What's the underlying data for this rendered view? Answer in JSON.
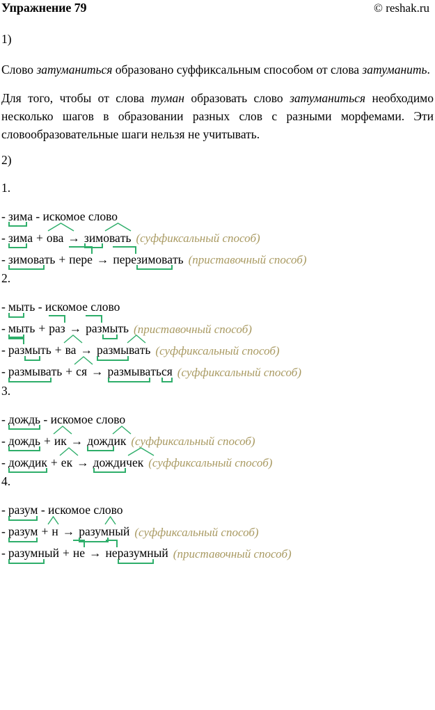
{
  "header": {
    "exercise_title": "Упражнение 79",
    "copyright": "© reshak.ru"
  },
  "parts": {
    "part1_label": "1)",
    "part2_label": "2)"
  },
  "paragraphs": {
    "p1_a": "Слово ",
    "p1_em1": "затуманиться",
    "p1_b": " образовано суффиксальным способом от слова ",
    "p1_em2": "затуманить",
    "p1_c": ".",
    "p2_a": "Для того, чтобы от слова ",
    "p2_em1": "туман",
    "p2_b": " образовать слово ",
    "p2_em2": "затуманиться",
    "p2_c": " необходимо несколько шагов в образовании разных слов с разными морфемами. Эти словообразовательные шаги нельзя не учитывать."
  },
  "common": {
    "dash": "-",
    "plus": "+",
    "arrow": "→",
    "target_word_note": "- искомое слово",
    "method_suffix": "(суффиксальный способ)",
    "method_prefix": "(приставочный способ)"
  },
  "colors": {
    "morpheme_green": "#2eae6a",
    "method_brown": "#a99a62",
    "text_black": "#000000",
    "page_background": "#ffffff"
  },
  "groups": [
    {
      "number": "1.",
      "base_word": {
        "root": "зим",
        "tail": "а"
      },
      "steps": [
        {
          "left": {
            "root": "зим",
            "tail": "а"
          },
          "morpheme": "ова",
          "morpheme_type": "suffix",
          "result": {
            "pre": "",
            "root": "зим",
            "suffix": "ова",
            "tail": "ть"
          },
          "method": "(суффиксальный способ)"
        },
        {
          "left": {
            "root": "зимова",
            "tail": "ть"
          },
          "morpheme": "пере",
          "morpheme_type": "prefix",
          "result": {
            "pre": "пере",
            "root": "зимова",
            "suffix": "",
            "tail": "ть"
          },
          "method": "(приставочный способ)"
        }
      ]
    },
    {
      "number": "2.",
      "base_word": {
        "root": "мы",
        "tail": "ть"
      },
      "steps": [
        {
          "left": {
            "root": "мы",
            "tail": "ть"
          },
          "morpheme": "раз",
          "morpheme_type": "prefix",
          "result": {
            "pre": "раз",
            "root": "мы",
            "suffix": "",
            "tail": "ть"
          },
          "method": "(приставочный способ)"
        },
        {
          "left": {
            "pre": "раз",
            "root": "мы",
            "tail": "ть"
          },
          "morpheme": "ва",
          "morpheme_type": "suffix",
          "result": {
            "pre": "",
            "root": "размы",
            "suffix": "ва",
            "tail": "ть"
          },
          "method": "(суффиксальный способ)"
        },
        {
          "left": {
            "root": "размыва",
            "tail": "ть"
          },
          "morpheme": "ся",
          "morpheme_type": "suffix",
          "result": {
            "pre": "",
            "root": "размыва",
            "suffix": "ть",
            "tail": "ся"
          },
          "method": "(суффиксальный способ)"
        }
      ]
    },
    {
      "number": "3.",
      "base_word": {
        "root": "дождь",
        "tail": ""
      },
      "steps": [
        {
          "left": {
            "root": "дождь",
            "tail": ""
          },
          "morpheme": "ик",
          "morpheme_type": "suffix",
          "result": {
            "pre": "",
            "root": "дожд",
            "suffix": "ик",
            "tail": ""
          },
          "method": "(суффиксальный способ)"
        },
        {
          "left": {
            "root": "дождик",
            "tail": ""
          },
          "morpheme": "ек",
          "morpheme_type": "suffix",
          "result": {
            "pre": "",
            "root": "дожди",
            "suffix": "чек",
            "tail": ""
          },
          "method": "(суффиксальный способ)"
        }
      ]
    },
    {
      "number": "4.",
      "base_word": {
        "root": "разум",
        "tail": ""
      },
      "steps": [
        {
          "left": {
            "root": "разум",
            "tail": ""
          },
          "morpheme": "н",
          "morpheme_type": "suffix",
          "result": {
            "pre": "",
            "root": "разум",
            "suffix": "н",
            "tail": "ый"
          },
          "method": "(суффиксальный способ)"
        },
        {
          "left": {
            "root": "разумн",
            "tail": "ый"
          },
          "morpheme": "не",
          "morpheme_type": "prefix",
          "result": {
            "pre": "не",
            "root": "разумн",
            "suffix": "",
            "tail": "ый"
          },
          "method": "(приставочный способ)"
        }
      ]
    }
  ]
}
